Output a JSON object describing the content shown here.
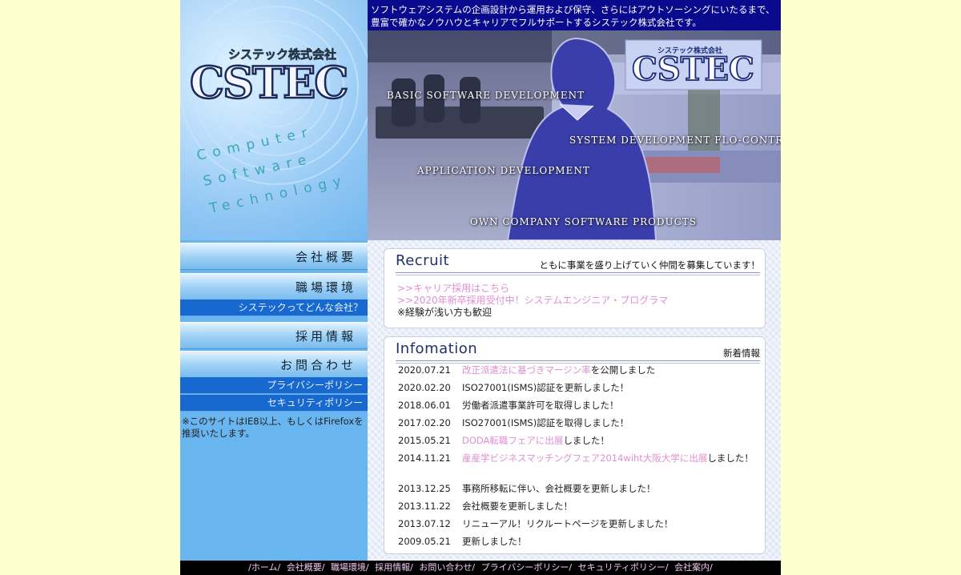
{
  "logo": {
    "company_jp": "システック株式会社",
    "wordmark": "CSTEC",
    "tagline": [
      "Computer",
      "Software",
      "Technology"
    ]
  },
  "nav": [
    {
      "label": "会社概要"
    },
    {
      "label": "職場環境",
      "sub": "システックってどんな会社？"
    },
    {
      "label": "採用情報"
    },
    {
      "label": "お問合わせ",
      "subs": [
        "プライバシーポリシー",
        "セキュリティポリシー"
      ]
    }
  ],
  "notice": "※このサイトはIE8以上、もしくはFirefoxを推奨いたします。",
  "banner": "ソフトウェアシステムの企画設計から運用および保守、さらにはアウトソーシングにいたるまで、豊富で確かなノウハウとキャリアでフルサポートするシステック株式会社です。",
  "hero": {
    "sign": "CSTEC",
    "sign_sub": "システック株式会社",
    "labels": [
      "BASIC SOFTWARE DEVELOPMENT",
      "SYSTEM DEVELOPMENT FLO-CONTROL",
      "APPLICATION DEVELOPMENT",
      "OWN COMPANY SOFTWARE PRODUCTS"
    ]
  },
  "recruit": {
    "title": "Recruit",
    "subtitle": "ともに事業を盛り上げていく仲間を募集しています！",
    "links": [
      ">>キャリア採用はこちら",
      ">>2020年新卒採用受付中！システムエンジニア・プログラマ"
    ],
    "note": "※経験が浅い方も歓迎"
  },
  "info": {
    "title": "Infomation",
    "subtitle": "新着情報",
    "items": [
      {
        "date": "2020.07.21",
        "link": "改正派遣法に基づきマージン率",
        "text": "を公開しました"
      },
      {
        "date": "2020.02.20",
        "link": "",
        "text": "ISO27001(ISMS)認証を更新しました！"
      },
      {
        "date": "2018.06.01",
        "link": "",
        "text": "労働者派遣事業許可を取得しました！"
      },
      {
        "date": "2017.02.20",
        "link": "",
        "text": "ISO27001(ISMS)認証を取得しました！"
      },
      {
        "date": "2015.05.21",
        "link": "DODA転職フェアに出展",
        "text": "しました！"
      },
      {
        "date": "2014.11.21",
        "link": "産産学ビジネスマッチングフェア2014wiht大阪大学に出展",
        "text": "しました！"
      },
      {
        "date": "2013.12.25",
        "link": "",
        "text": "事務所移転に伴い、会社概要を更新しました！"
      },
      {
        "date": "2013.11.22",
        "link": "",
        "text": "会社概要を更新しました！"
      },
      {
        "date": "2013.07.12",
        "link": "",
        "text": "リニューアル！リクルートページを更新しました！"
      },
      {
        "date": "2009.05.21",
        "link": "",
        "text": "更新しました！"
      }
    ]
  },
  "footer": [
    "/ホーム/",
    "会社概要/",
    "職場環境/",
    "採用情報/",
    "お問い合わせ/",
    "プライバシーポリシー/",
    "セキュリティポリシー/",
    "会社案内/"
  ],
  "colors": {
    "background": "#ffffd0",
    "nav_sub": "#1768cf",
    "banner": "#0a0a8e",
    "link": "#e08fd2"
  }
}
